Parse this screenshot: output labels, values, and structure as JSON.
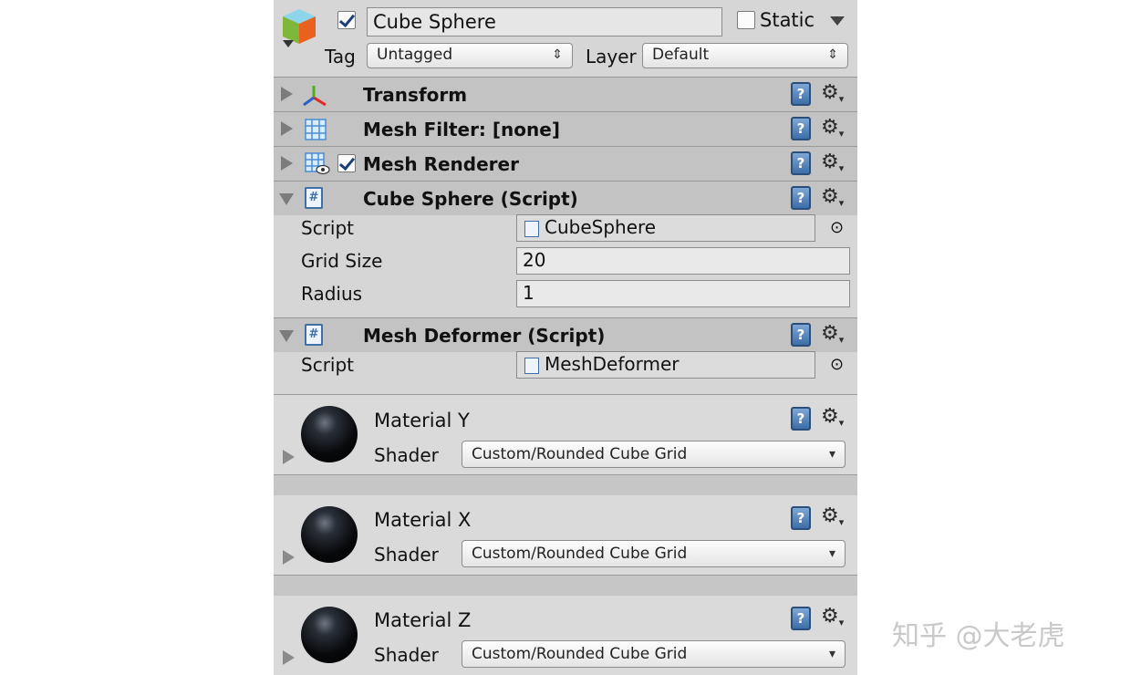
{
  "object": {
    "active": true,
    "name": "Cube Sphere",
    "static_label": "Static",
    "static_checked": false,
    "tag_label": "Tag",
    "tag_value": "Untagged",
    "layer_label": "Layer",
    "layer_value": "Default"
  },
  "components": {
    "transform": {
      "title": "Transform"
    },
    "mesh_filter": {
      "title": "Mesh Filter: [none]"
    },
    "mesh_renderer": {
      "title": "Mesh Renderer",
      "enabled": true
    },
    "cube_sphere": {
      "title": "Cube Sphere (Script)",
      "fields": [
        {
          "label": "Script",
          "value": "CubeSphere"
        },
        {
          "label": "Grid Size",
          "value": "20"
        },
        {
          "label": "Radius",
          "value": "1"
        }
      ]
    },
    "mesh_deformer": {
      "title": "Mesh Deformer (Script)",
      "fields": [
        {
          "label": "Script",
          "value": "MeshDeformer"
        }
      ]
    }
  },
  "materials": [
    {
      "name": "Material Y",
      "shader_label": "Shader",
      "shader": "Custom/Rounded Cube Grid"
    },
    {
      "name": "Material X",
      "shader_label": "Shader",
      "shader": "Custom/Rounded Cube Grid"
    },
    {
      "name": "Material Z",
      "shader_label": "Shader",
      "shader": "Custom/Rounded Cube Grid"
    }
  ],
  "icons": {
    "help": "?",
    "gear": "⚙",
    "gear_arrow": "▾",
    "popup_arrows": "⇕",
    "dropdown_arrow": "▾",
    "object_picker": "⊙",
    "script": "#"
  },
  "watermark": "知乎 @大老虎"
}
